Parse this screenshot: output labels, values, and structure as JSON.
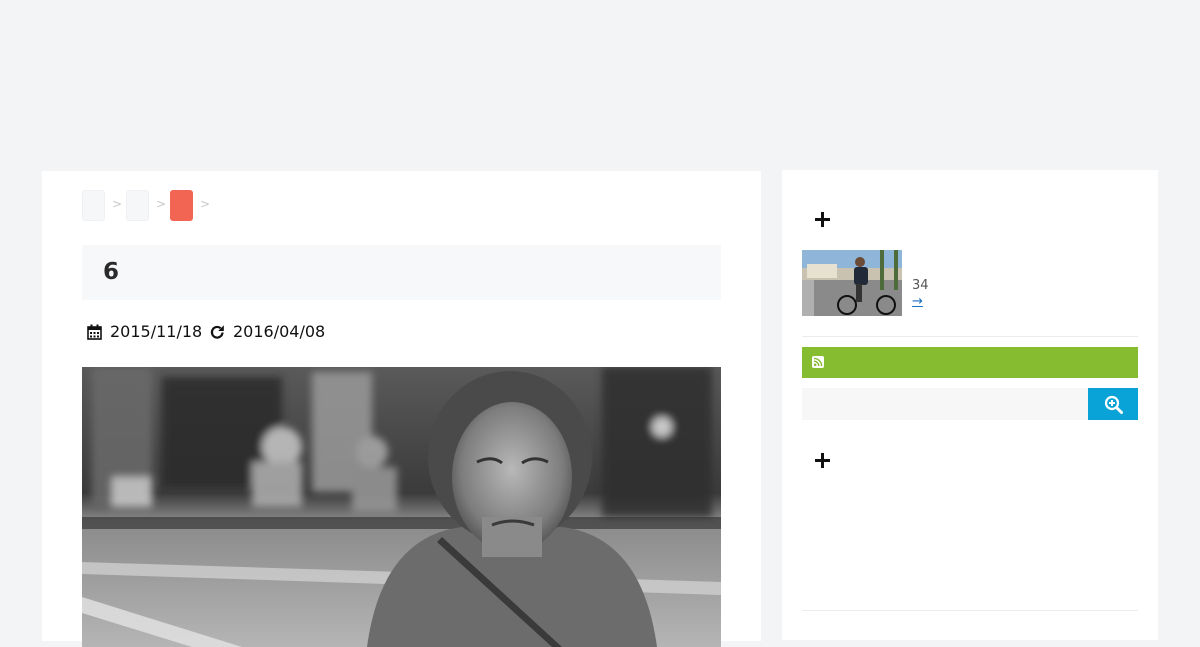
{
  "breadcrumb": {
    "items": [
      {
        "label": ""
      },
      {
        "label": ""
      },
      {
        "label": ""
      }
    ],
    "separator": ">"
  },
  "article": {
    "title": "6",
    "published_date": "2015/11/18",
    "updated_date": "2016/04/08",
    "published_icon": "calendar-icon",
    "updated_icon": "refresh-icon"
  },
  "sidebar": {
    "popular": {
      "header_icon": "plus-icon",
      "count": "34",
      "more_link": "→"
    },
    "rss": {
      "icon": "rss-icon",
      "label": ""
    },
    "search": {
      "placeholder": "",
      "button_icon": "zoom-in-icon"
    },
    "second_widget": {
      "header_icon": "plus-icon"
    }
  },
  "colors": {
    "page_bg": "#f3f4f6",
    "breadcrumb_active": "#f26552",
    "rss_bar": "#86bd30",
    "search_button": "#0aa3d8",
    "link": "#1a6fc4"
  }
}
